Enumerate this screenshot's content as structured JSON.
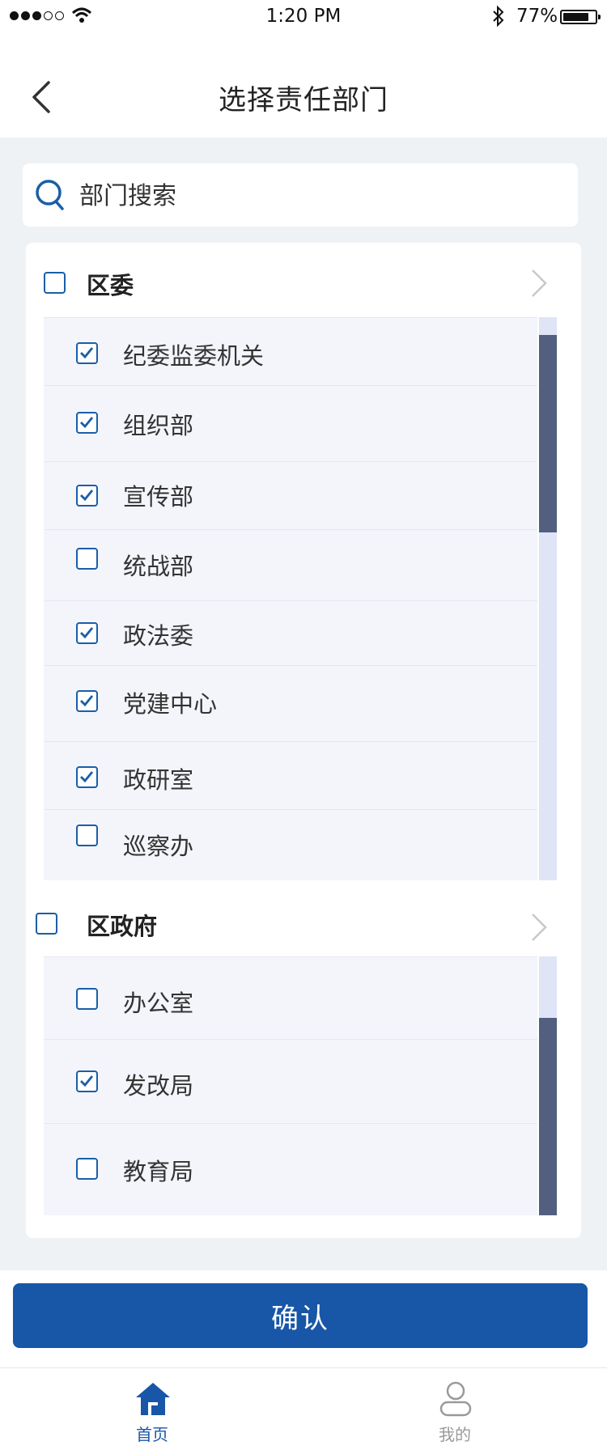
{
  "status_bar": {
    "time": "1:20 PM",
    "battery": "77%"
  },
  "header": {
    "title": "选择责任部门"
  },
  "search": {
    "placeholder": "部门搜索"
  },
  "groups": [
    {
      "label": "区委",
      "checked": false,
      "items": [
        {
          "label": "纪委监委机关",
          "checked": true
        },
        {
          "label": "组织部",
          "checked": true
        },
        {
          "label": "宣传部",
          "checked": true
        },
        {
          "label": "统战部",
          "checked": false
        },
        {
          "label": "政法委",
          "checked": true
        },
        {
          "label": "党建中心",
          "checked": true
        },
        {
          "label": "政研室",
          "checked": true
        },
        {
          "label": "巡察办",
          "checked": false
        }
      ]
    },
    {
      "label": "区政府",
      "checked": false,
      "items": [
        {
          "label": "办公室",
          "checked": false
        },
        {
          "label": "发改局",
          "checked": true
        },
        {
          "label": "教育局",
          "checked": false
        }
      ]
    }
  ],
  "confirm_button": {
    "label": "确认"
  },
  "tabbar": {
    "items": [
      {
        "label": "首页",
        "icon": "home-icon",
        "active": true
      },
      {
        "label": "我的",
        "icon": "user-icon",
        "active": false
      }
    ]
  },
  "colors": {
    "accent": "#1856a7",
    "scroll_thumb": "#535f7f",
    "scroll_track": "#dfe5f6"
  }
}
